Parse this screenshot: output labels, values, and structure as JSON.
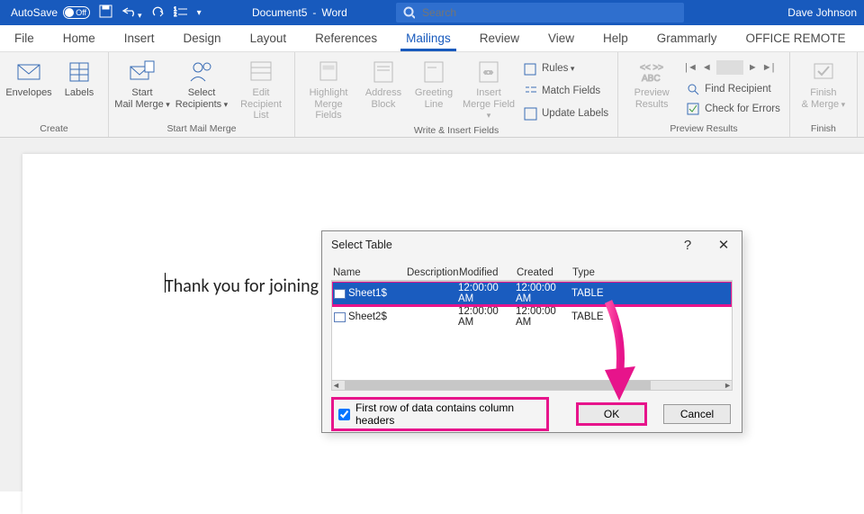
{
  "titlebar": {
    "autosave_label": "AutoSave",
    "autosave_state": "Off",
    "doc_name": "Document5",
    "app_name": "Word",
    "search_placeholder": "Search",
    "user": "Dave Johnson"
  },
  "tabs": [
    "File",
    "Home",
    "Insert",
    "Design",
    "Layout",
    "References",
    "Mailings",
    "Review",
    "View",
    "Help",
    "Grammarly",
    "OFFICE REMOTE"
  ],
  "active_tab": 6,
  "ribbon": {
    "groups": [
      {
        "label": "Create",
        "items": [
          {
            "t": "big",
            "label": "Envelopes",
            "icon": "envelope"
          },
          {
            "t": "big",
            "label": "Labels",
            "icon": "label"
          }
        ]
      },
      {
        "label": "Start Mail Merge",
        "items": [
          {
            "t": "big",
            "label": "Start Mail Merge",
            "icon": "mailmerge",
            "drop": true,
            "wide": true
          },
          {
            "t": "big",
            "label": "Select Recipients",
            "icon": "recipients",
            "drop": true,
            "wide": true
          },
          {
            "t": "big",
            "label": "Edit Recipient List",
            "icon": "editlist",
            "dim": true,
            "wide": true
          }
        ]
      },
      {
        "label": "Write & Insert Fields",
        "items": [
          {
            "t": "big",
            "label": "Highlight Merge Fields",
            "icon": "highlight",
            "dim": true,
            "wide": true
          },
          {
            "t": "big",
            "label": "Address Block",
            "icon": "address",
            "dim": true
          },
          {
            "t": "big",
            "label": "Greeting Line",
            "icon": "greeting",
            "dim": true
          },
          {
            "t": "big",
            "label": "Insert Merge Field",
            "icon": "insertfield",
            "dim": true,
            "drop": true,
            "wide": true
          },
          {
            "t": "stack",
            "items": [
              {
                "label": "Rules",
                "icon": "rules",
                "drop": true
              },
              {
                "label": "Match Fields",
                "icon": "match"
              },
              {
                "label": "Update Labels",
                "icon": "update"
              }
            ]
          }
        ]
      },
      {
        "label": "Preview Results",
        "items": [
          {
            "t": "big",
            "label": "Preview Results",
            "icon": "preview",
            "dim": true,
            "wide": true
          },
          {
            "t": "stack2",
            "nav": true,
            "items": [
              {
                "label": "Find Recipient",
                "icon": "find"
              },
              {
                "label": "Check for Errors",
                "icon": "check"
              }
            ]
          }
        ]
      },
      {
        "label": "Finish",
        "items": [
          {
            "t": "big",
            "label": "Finish & Merge",
            "icon": "finish",
            "dim": true,
            "drop": true,
            "wide": true
          }
        ]
      }
    ]
  },
  "document": {
    "body_text": "Thank you for joining the"
  },
  "dialog": {
    "title": "Select Table",
    "columns": [
      "Name",
      "Description",
      "Modified",
      "Created",
      "Type"
    ],
    "rows": [
      {
        "name": "Sheet1$",
        "desc": "",
        "modified": "12:00:00 AM",
        "created": "12:00:00 AM",
        "type": "TABLE",
        "selected": true
      },
      {
        "name": "Sheet2$",
        "desc": "",
        "modified": "12:00:00 AM",
        "created": "12:00:00 AM",
        "type": "TABLE",
        "selected": false
      }
    ],
    "checkbox_label": "First row of data contains column headers",
    "checkbox_checked": true,
    "ok": "OK",
    "cancel": "Cancel"
  }
}
